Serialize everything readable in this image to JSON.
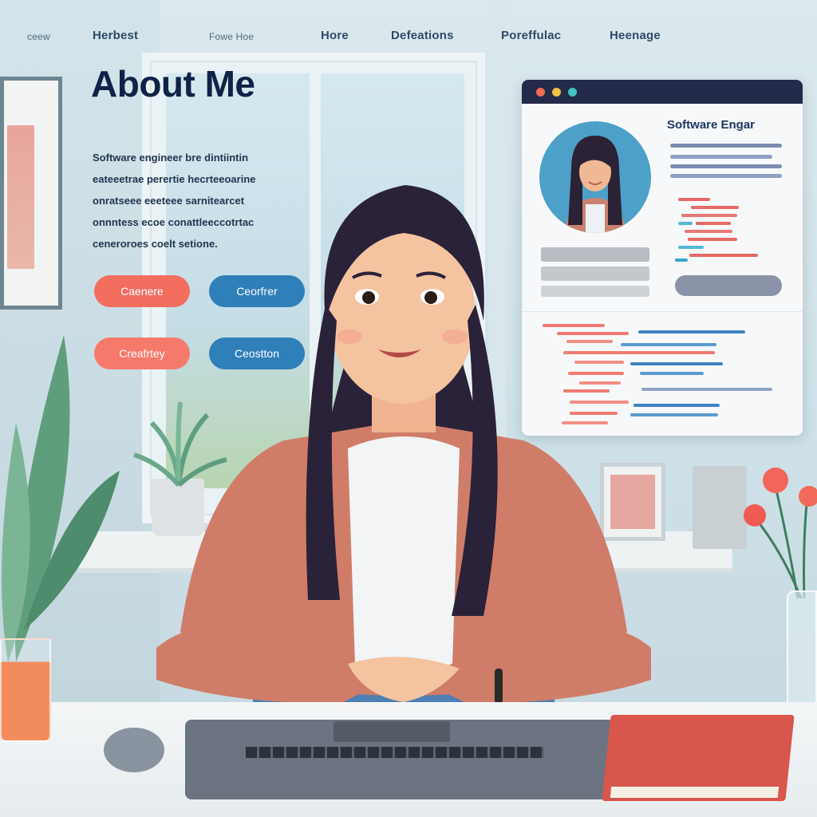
{
  "nav": {
    "items": [
      "ceew",
      "Herbest",
      "Fowe Hoe",
      "Hore",
      "Defeations",
      "Poreffulac",
      "Heenage"
    ]
  },
  "about": {
    "title": "About Me",
    "lead": "Software engineer",
    "lines": [
      "Software engineer bre dintiintin",
      "eateeetrae perertie hecrteeoarine",
      "onratseee eeeteee sarnitearcet",
      "onnntess ecoe conattleeccotrtac",
      "ceneroroes coelt setione."
    ]
  },
  "buttons": {
    "row1": [
      "Caenere",
      "Ceorfrer"
    ],
    "row2": [
      "Creafrtey",
      "Ceostton"
    ]
  },
  "browser_mockup": {
    "card_title": "Software Engar"
  },
  "colors": {
    "accent_coral": "#f36e5f",
    "accent_blue": "#2f7fb9",
    "title_navy": "#0f2247",
    "browser_bar": "#242a4a",
    "dot_red": "#ef6a54",
    "dot_yellow": "#f2c247",
    "dot_teal": "#3cc4c0"
  }
}
